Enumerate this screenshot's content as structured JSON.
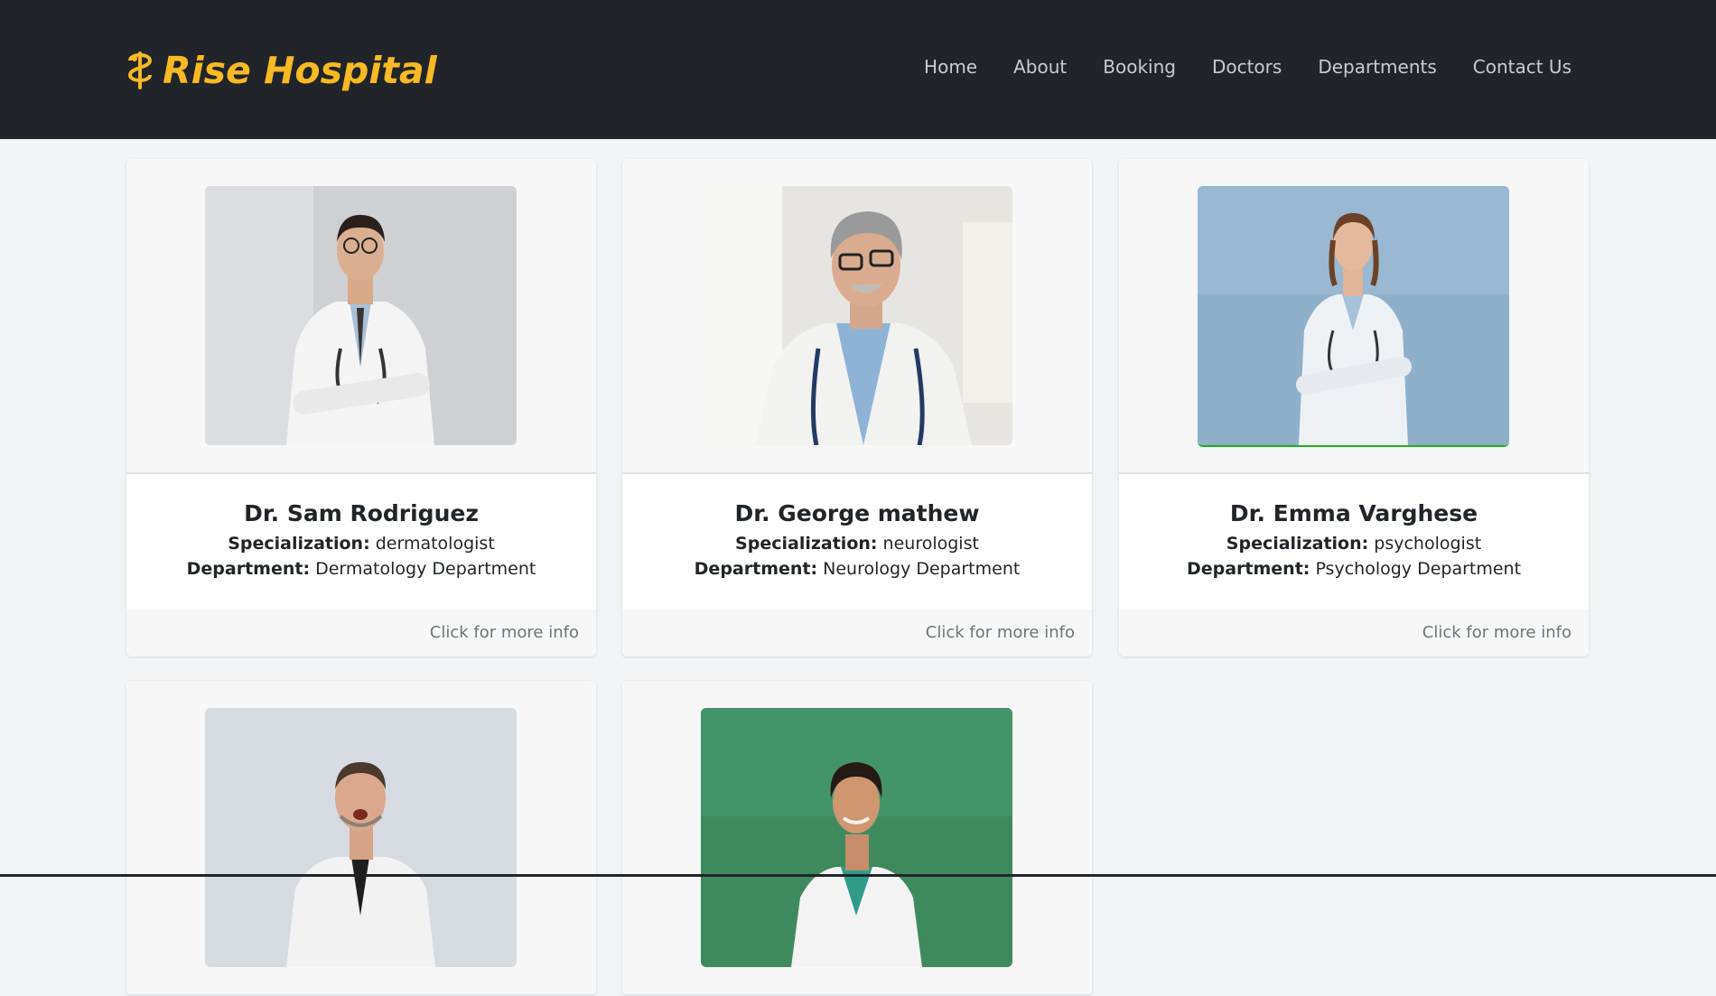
{
  "brand": {
    "name": "Rise Hospital",
    "icon": "caduceus-dollar-icon",
    "color": "#f7b924"
  },
  "nav": [
    {
      "label": "Home"
    },
    {
      "label": "About"
    },
    {
      "label": "Booking"
    },
    {
      "label": "Doctors"
    },
    {
      "label": "Departments"
    },
    {
      "label": "Contact Us"
    }
  ],
  "doctors": [
    {
      "name": "Dr. Sam Rodriguez",
      "spec_label": "Specialization:",
      "spec": "dermatologist",
      "dept_label": "Department:",
      "dept": "Dermatology Department",
      "footer": "Click for more info"
    },
    {
      "name": "Dr. George mathew",
      "spec_label": "Specialization:",
      "spec": "neurologist",
      "dept_label": "Department:",
      "dept": "Neurology Department",
      "footer": "Click for more info"
    },
    {
      "name": "Dr. Emma Varghese",
      "spec_label": "Specialization:",
      "spec": "psychologist",
      "dept_label": "Department:",
      "dept": "Psychology Department",
      "footer": "Click for more info"
    },
    {
      "name": "",
      "footer": ""
    },
    {
      "name": "",
      "footer": ""
    }
  ],
  "colors": {
    "navbar": "#212529",
    "page": "#f1f3f5"
  }
}
